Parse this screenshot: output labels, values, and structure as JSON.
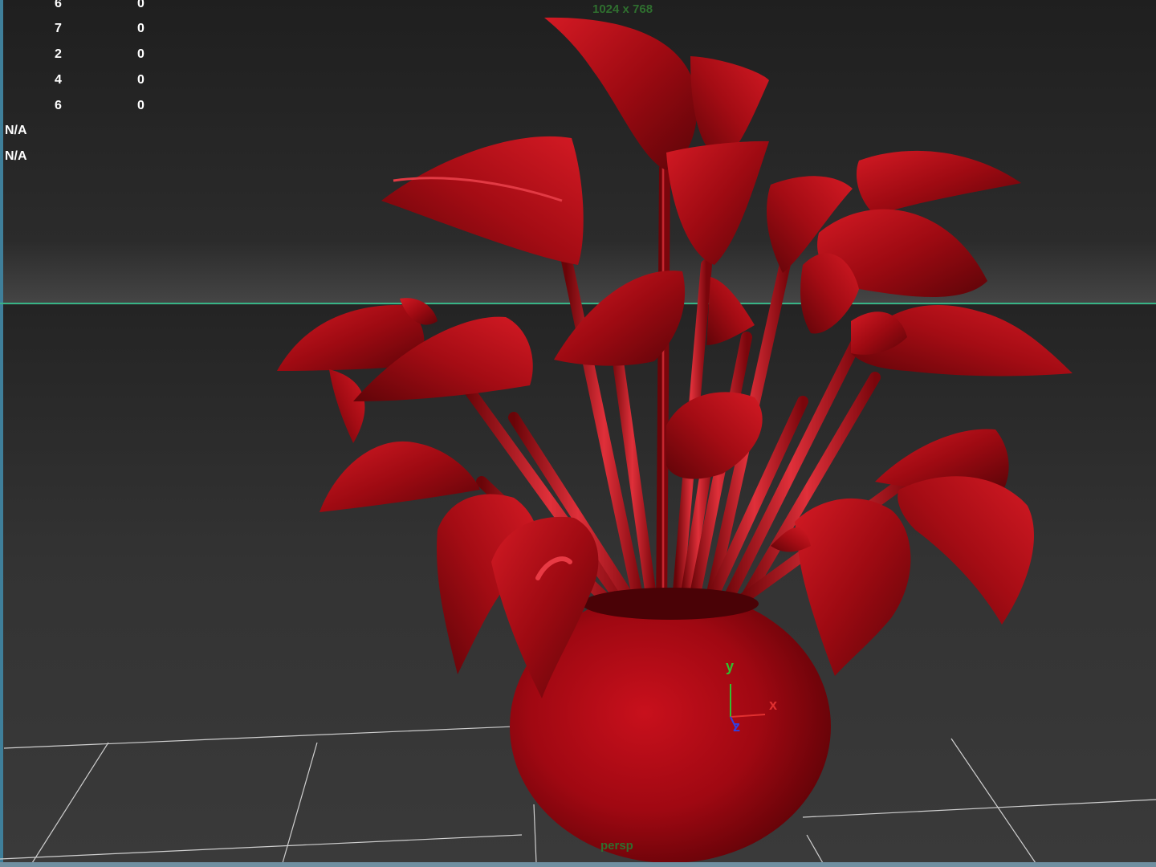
{
  "viewport": {
    "resolution_label": "1024 x 768",
    "camera_label": "persp",
    "horizon_color": "#38b486",
    "background_color": "#2b2b2b",
    "model_color": "#b00a14"
  },
  "hud": {
    "rows": [
      {
        "num": "6",
        "val": "0"
      },
      {
        "num": "7",
        "val": "0"
      },
      {
        "num": "2",
        "val": "0"
      },
      {
        "num": "4",
        "val": "0"
      },
      {
        "num": "6",
        "val": "0"
      }
    ],
    "na_rows": [
      "N/A",
      "N/A"
    ]
  },
  "axis_gizmo": {
    "x_label": "x",
    "y_label": "y",
    "z_label": "z",
    "x_color": "#e03030",
    "y_color": "#30c030",
    "z_color": "#3040e0"
  },
  "icons": [
    "view-axis-gizmo-icon"
  ]
}
